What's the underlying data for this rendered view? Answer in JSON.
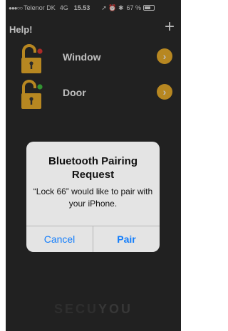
{
  "status_bar": {
    "signal_dots": "●●●○○",
    "carrier": "Telenor DK",
    "network": "4G",
    "time": "15.53",
    "status_icons": "➚ ⏰ ✱",
    "battery_percent": "67 %",
    "battery_level": 0.67
  },
  "nav": {
    "help_label": "Help!",
    "add_glyph": "+"
  },
  "locks": [
    {
      "label": "Window",
      "status_color": "#e53935",
      "chevron": "›"
    },
    {
      "label": "Door",
      "status_color": "#43c543",
      "chevron": "›"
    }
  ],
  "alert": {
    "title": "Bluetooth Pairing Request",
    "message": "“Lock 66” would like to pair with your iPhone.",
    "cancel_label": "Cancel",
    "pair_label": "Pair"
  },
  "brand": {
    "part1": "SECU",
    "part2": "YOU"
  },
  "colors": {
    "background": "#2d2d2d",
    "lock_yellow": "#f5b52d",
    "ios_blue": "#147efb"
  }
}
